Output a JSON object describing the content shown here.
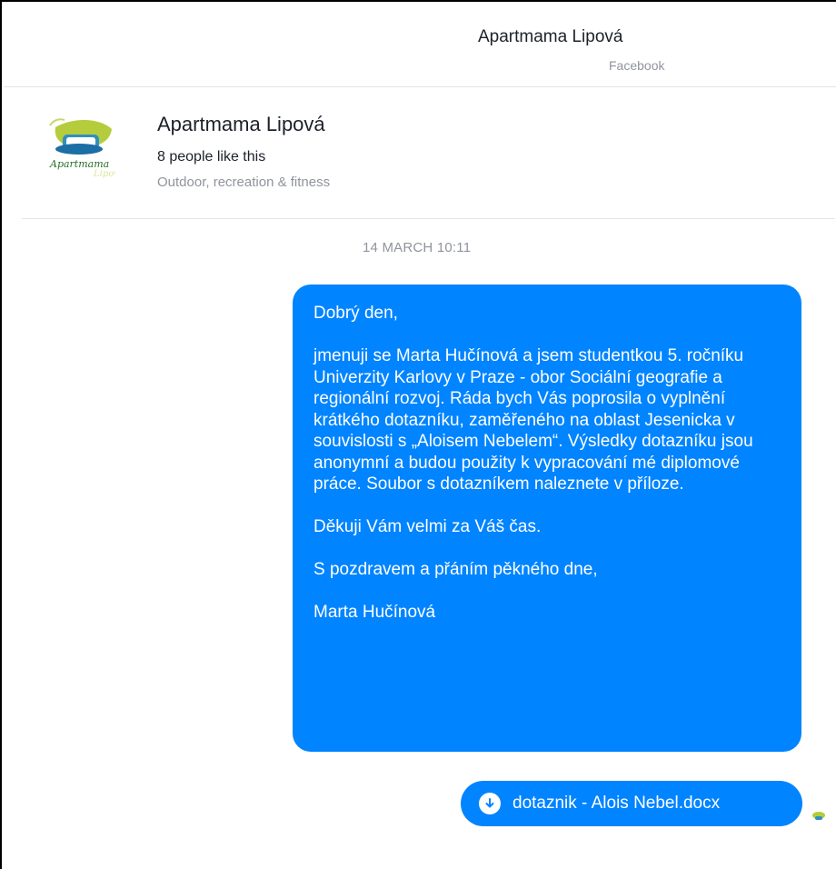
{
  "header": {
    "title": "Apartmama Lipová",
    "subtitle": "Facebook"
  },
  "profile": {
    "name": "Apartmama Lipová",
    "likes": "8 people like this",
    "category": "Outdoor, recreation & fitness",
    "logo_icon": "page-logo"
  },
  "conversation": {
    "timestamp": "14 MARCH 10:11",
    "message": {
      "paragraphs": [
        "Dobrý den,",
        "jmenuji se Marta Hučínová a jsem studentkou 5. ročníku Univerzity Karlovy v Praze - obor Sociální geografie a regionální rozvoj. Ráda bych Vás poprosila o vyplnění krátkého dotazníku, zaměřeného na oblast Jesenicka v souvislosti s „Aloisem Nebelem“. Výsledky dotazníku jsou anonymní a budou použity k vypracování mé diplomové práce. Soubor s dotazníkem naleznete v příloze.",
        "Děkuji Vám velmi za Váš čas.",
        "S pozdravem a přáním pěkného dne,",
        "Marta Hučínová"
      ]
    },
    "attachment": {
      "filename": "dotaznik - Alois Nebel.docx",
      "icon": "download-icon"
    },
    "seen_icon": "seen-avatar-icon"
  },
  "colors": {
    "bubble": "#0084ff",
    "muted": "#90949c",
    "text": "#1d2129"
  }
}
